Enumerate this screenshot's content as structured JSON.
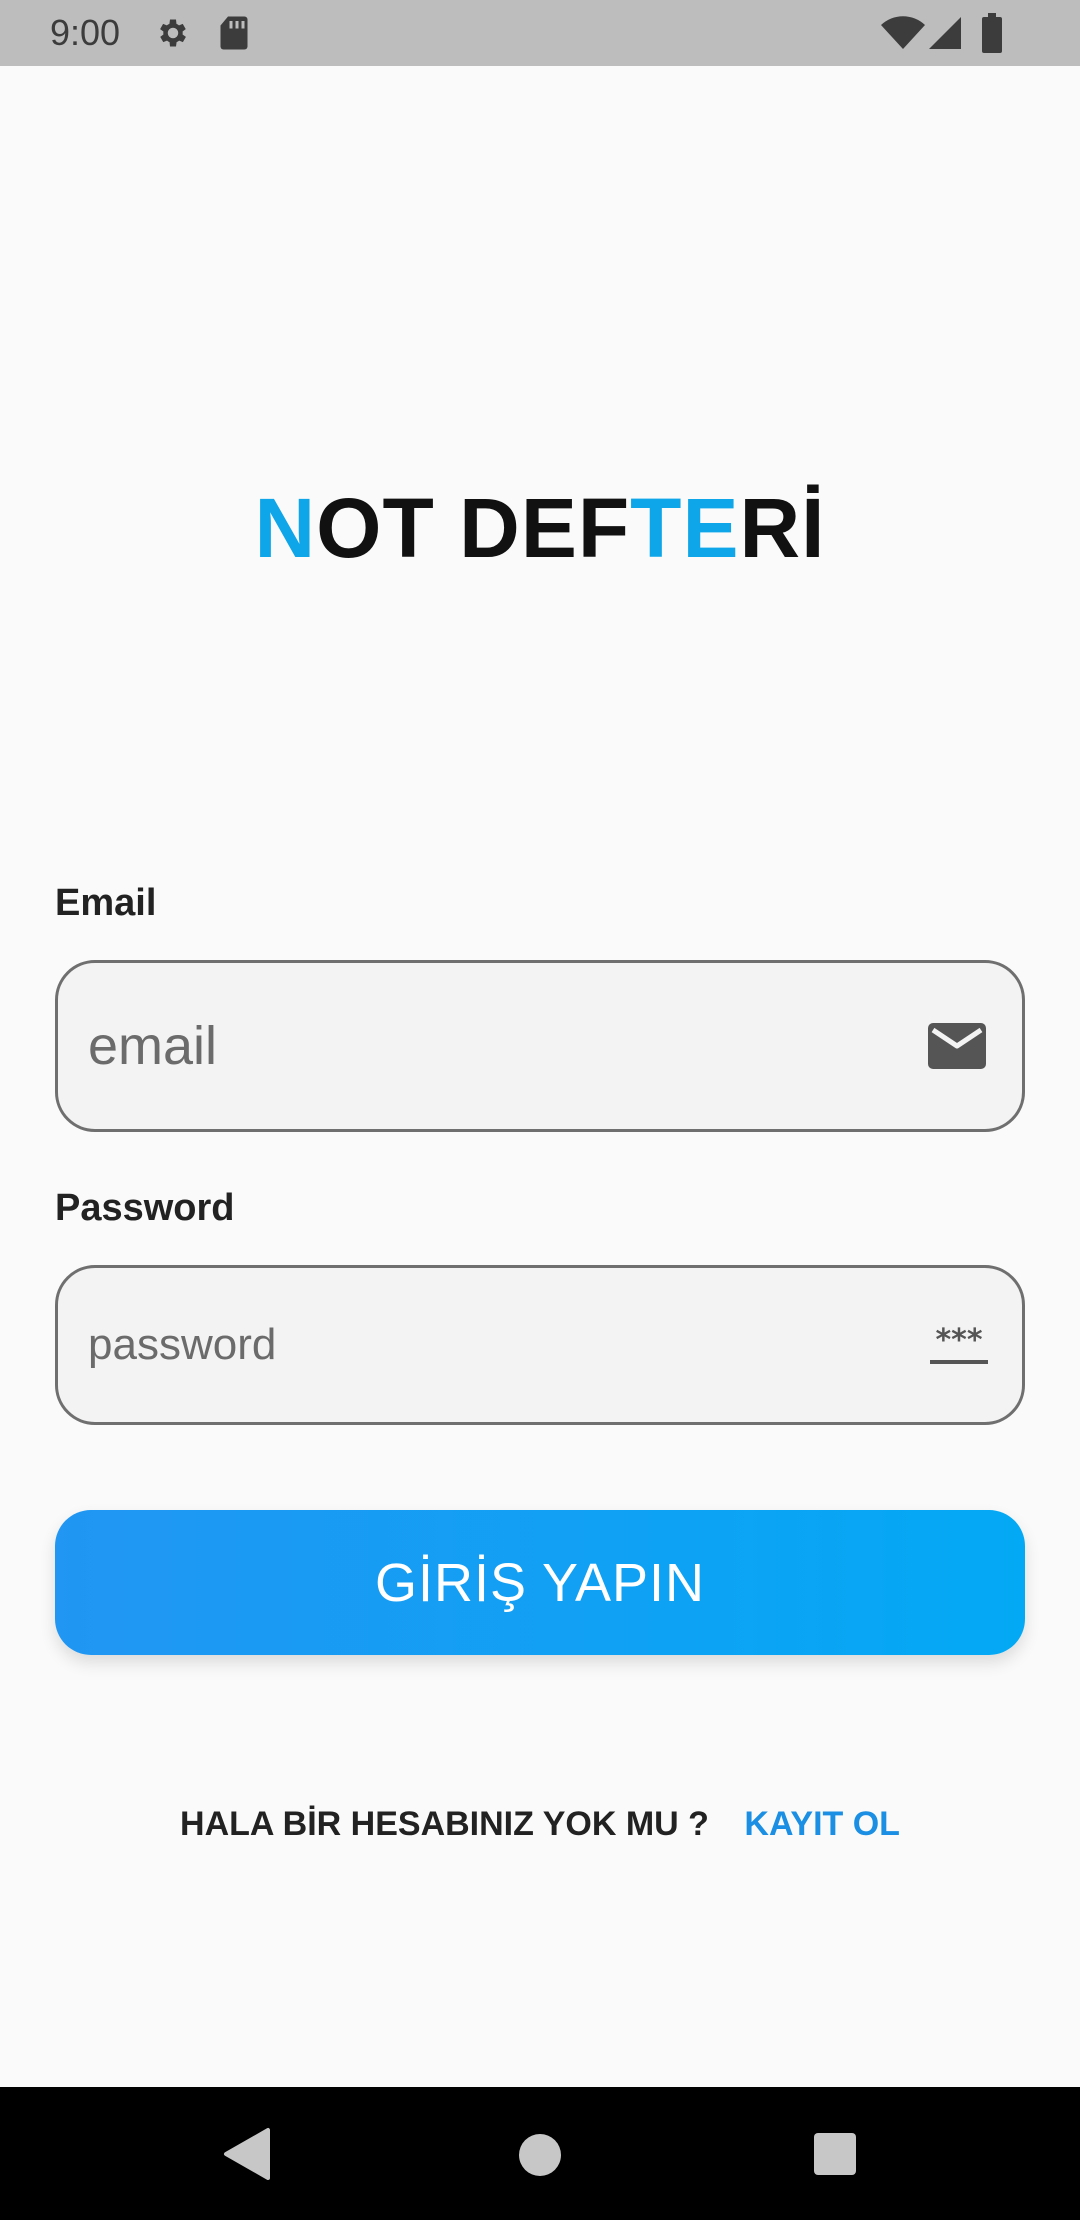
{
  "status_bar": {
    "time": "9:00",
    "icons": [
      "gear-icon",
      "sd-card-icon",
      "wifi-icon",
      "cell-signal-icon",
      "battery-icon"
    ]
  },
  "app": {
    "title_parts": [
      {
        "text": "N",
        "accent": true
      },
      {
        "text": "OT",
        "accent": false
      },
      {
        "text": "T",
        "accent": true
      },
      {
        "text": " DEF",
        "accent": false
      },
      {
        "text": "TE",
        "accent": true
      },
      {
        "text": "Rİ",
        "accent": false
      }
    ],
    "accent_color": "#0ea5e9"
  },
  "form": {
    "email_label": "Email",
    "email_placeholder": "email",
    "email_value": "",
    "password_label": "Password",
    "password_placeholder": "password",
    "password_value": "",
    "login_label": "GİRİŞ YAPIN"
  },
  "signup": {
    "question": "HALA BİR HESABINIZ YOK MU ?",
    "link": "KAYIT OL",
    "link_color": "#1a8fe3"
  },
  "nav_bar": {
    "icons": [
      "back-icon",
      "home-icon",
      "recents-icon"
    ]
  }
}
